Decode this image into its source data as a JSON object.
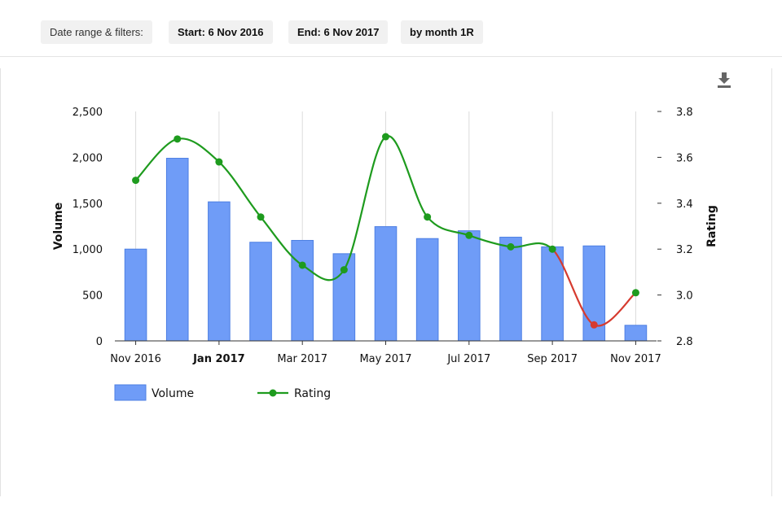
{
  "filters": {
    "label": "Date range & filters:",
    "start": "Start: 6 Nov 2016",
    "end": "End: 6 Nov 2017",
    "grouping": "by month 1R"
  },
  "toolbar": {
    "download_icon": "download-icon"
  },
  "chart_data": {
    "type": "bar+line",
    "x_tick_labels": [
      "Nov 2016",
      "Jan 2017",
      "Mar 2017",
      "May 2017",
      "Jul 2017",
      "Sep 2017",
      "Nov 2017"
    ],
    "x_tick_bold": "Jan 2017",
    "categories": [
      "Nov 2016",
      "Dec 2016",
      "Jan 2017",
      "Feb 2017",
      "Mar 2017",
      "Apr 2017",
      "May 2017",
      "Jun 2017",
      "Jul 2017",
      "Aug 2017",
      "Sep 2017",
      "Oct 2017",
      "Nov 2017"
    ],
    "series": [
      {
        "name": "Volume",
        "type": "bar",
        "axis": "left",
        "values": [
          1000,
          1990,
          1515,
          1075,
          1095,
          950,
          1245,
          1115,
          1200,
          1130,
          1025,
          1035,
          170
        ],
        "color": "#6f9cf7"
      },
      {
        "name": "Rating",
        "type": "line",
        "axis": "right",
        "values": [
          3.5,
          3.68,
          3.58,
          3.34,
          3.13,
          3.11,
          3.69,
          3.34,
          3.26,
          3.21,
          3.2,
          2.87,
          3.01
        ],
        "color": "#1e9b1e",
        "low_color": "#d63b2f"
      }
    ],
    "y_left": {
      "title": "Volume",
      "range": [
        0,
        2500
      ],
      "ticks": [
        "0",
        "500",
        "1,000",
        "1,500",
        "2,000",
        "2,500"
      ]
    },
    "y_right": {
      "title": "Rating",
      "range": [
        2.8,
        3.8
      ],
      "ticks": [
        "2.8",
        "3.0",
        "3.2",
        "3.4",
        "3.6",
        "3.8"
      ]
    },
    "grid": "vertical",
    "legend": {
      "position": "bottom-left",
      "items": [
        "Volume",
        "Rating"
      ]
    }
  }
}
